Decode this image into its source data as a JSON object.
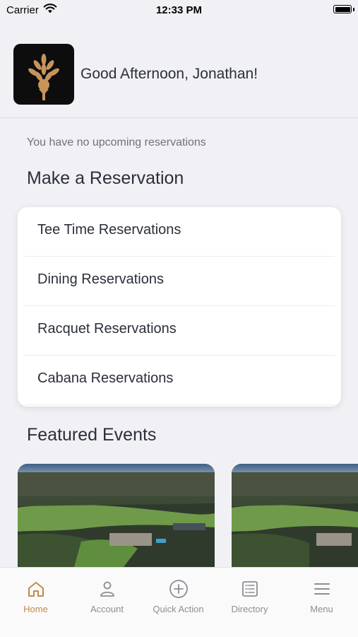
{
  "status_bar": {
    "carrier": "Carrier",
    "time": "12:33 PM"
  },
  "header": {
    "greeting": "Good Afternoon, Jonathan!",
    "logo_icon": "golf-tee-wheat-logo"
  },
  "reservations": {
    "empty_message": "You have no upcoming reservations",
    "section_title": "Make a Reservation",
    "items": [
      {
        "label": "Tee Time Reservations"
      },
      {
        "label": "Dining Reservations"
      },
      {
        "label": "Racquet Reservations"
      },
      {
        "label": "Cabana Reservations"
      }
    ]
  },
  "events": {
    "section_title": "Featured Events"
  },
  "tab_bar": {
    "tabs": [
      {
        "label": "Home",
        "icon": "home-icon",
        "active": true
      },
      {
        "label": "Account",
        "icon": "person-icon",
        "active": false
      },
      {
        "label": "Quick Action",
        "icon": "plus-circle-icon",
        "active": false
      },
      {
        "label": "Directory",
        "icon": "list-icon",
        "active": false
      },
      {
        "label": "Menu",
        "icon": "menu-icon",
        "active": false
      }
    ]
  },
  "colors": {
    "accent": "#c08a4f",
    "background": "#f1f1f5",
    "text": "#2b2f3a",
    "inactive": "#8c8e96"
  }
}
